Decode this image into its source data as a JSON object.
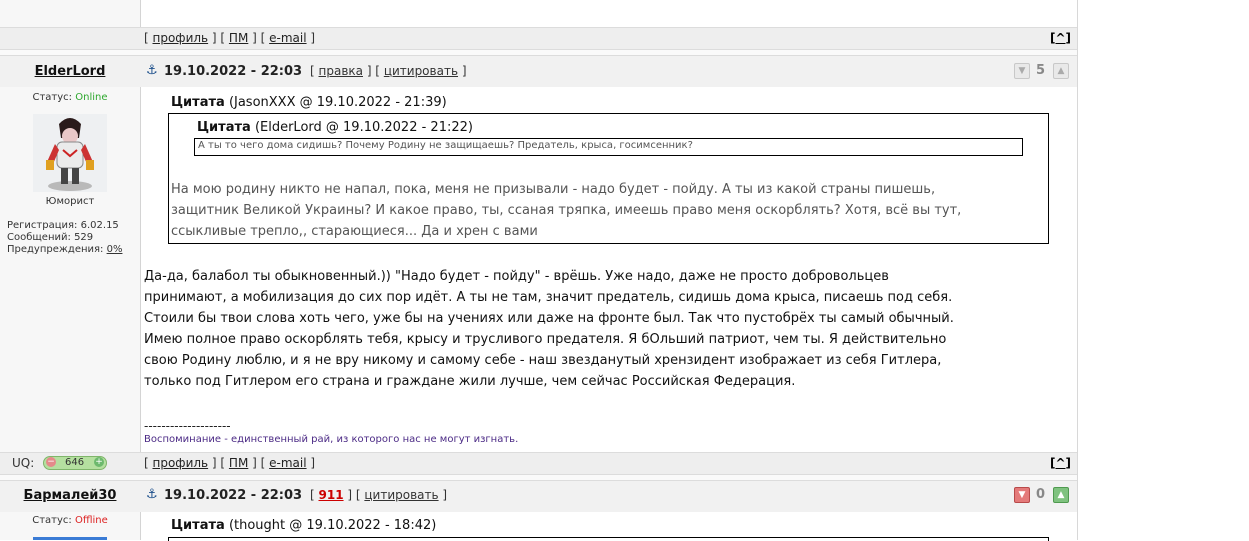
{
  "nav_links": {
    "profile": "профиль",
    "pm": "ПМ",
    "email": "e-mail"
  },
  "up_label": "^",
  "post1": {
    "username": "ElderLord",
    "date": "19.10.2022 - 22:03",
    "actions": {
      "edit": "правка",
      "quote": "цитировать"
    },
    "score": "5",
    "status_label": "Статус:",
    "status": "Online",
    "user_title": "Юморист",
    "stats": {
      "reg_label": "Регистрация:",
      "reg": "6.02.15",
      "msgs_label": "Сообщений:",
      "msgs": "529",
      "warn_label": "Предупреждения:",
      "warn": "0%"
    },
    "quote_outer": {
      "label": "Цитата",
      "meta": "(JasonXXX @ 19.10.2022 - 21:39)",
      "inner_label": "Цитата",
      "inner_meta": "(ElderLord @ 19.10.2022 - 21:22)",
      "inner_text": "А ты то чего дома сидишь? Почему Родину не защищаешь? Предатель, крыса, госимсенник?",
      "lines": [
        "На мою родину никто не напал, пока, меня не призывали - надо будет - пойду. А ты из какой страны пишешь,",
        "защитник Великой Украины? И какое право, ты, ссаная тряпка, имеешь право меня оскорблять? Хотя, всё вы тут,",
        "ссыкливые трепло,, старающиеся... Да и хрен с вами"
      ]
    },
    "body_lines": [
      "Да-да, балабол ты обыкновенный.)) \"Надо будет - пойду\" - врёшь. Уже надо, даже не просто добровольцев",
      "принимают, а мобилизация до сих пор идёт. А ты не там, значит предатель, сидишь дома крыса, писаешь под себя.",
      "Стоили бы твои слова хоть чего, уже бы на учениях или даже на фронте был. Так что пустобрёх ты самый обычный.",
      "Имею полное право оскорблять тебя, крысу и трусливого предателя. Я бОльший патриот, чем ты. Я действительно",
      "свою Родину люблю, и я не вру никому и самому себе - наш звезданутый хрензидент изображает из себя Гитлера,",
      "только под Гитлером его страна и граждане жили лучше, чем сейчас Российская Федерация."
    ],
    "sig_dashes": "--------------------",
    "sig_text": "Воспоминание - единственный рай, из которого нас не могут изгнать.",
    "uq_label": "UQ:",
    "uq_value": "646"
  },
  "post2": {
    "username": "Бармалей30",
    "date": "19.10.2022 - 22:03",
    "actions": {
      "num": "911",
      "quote": "цитировать"
    },
    "score": "0",
    "status_label": "Статус:",
    "status": "Offline",
    "quote": {
      "label": "Цитата",
      "meta": "(thought @ 19.10.2022 - 18:42)"
    }
  }
}
